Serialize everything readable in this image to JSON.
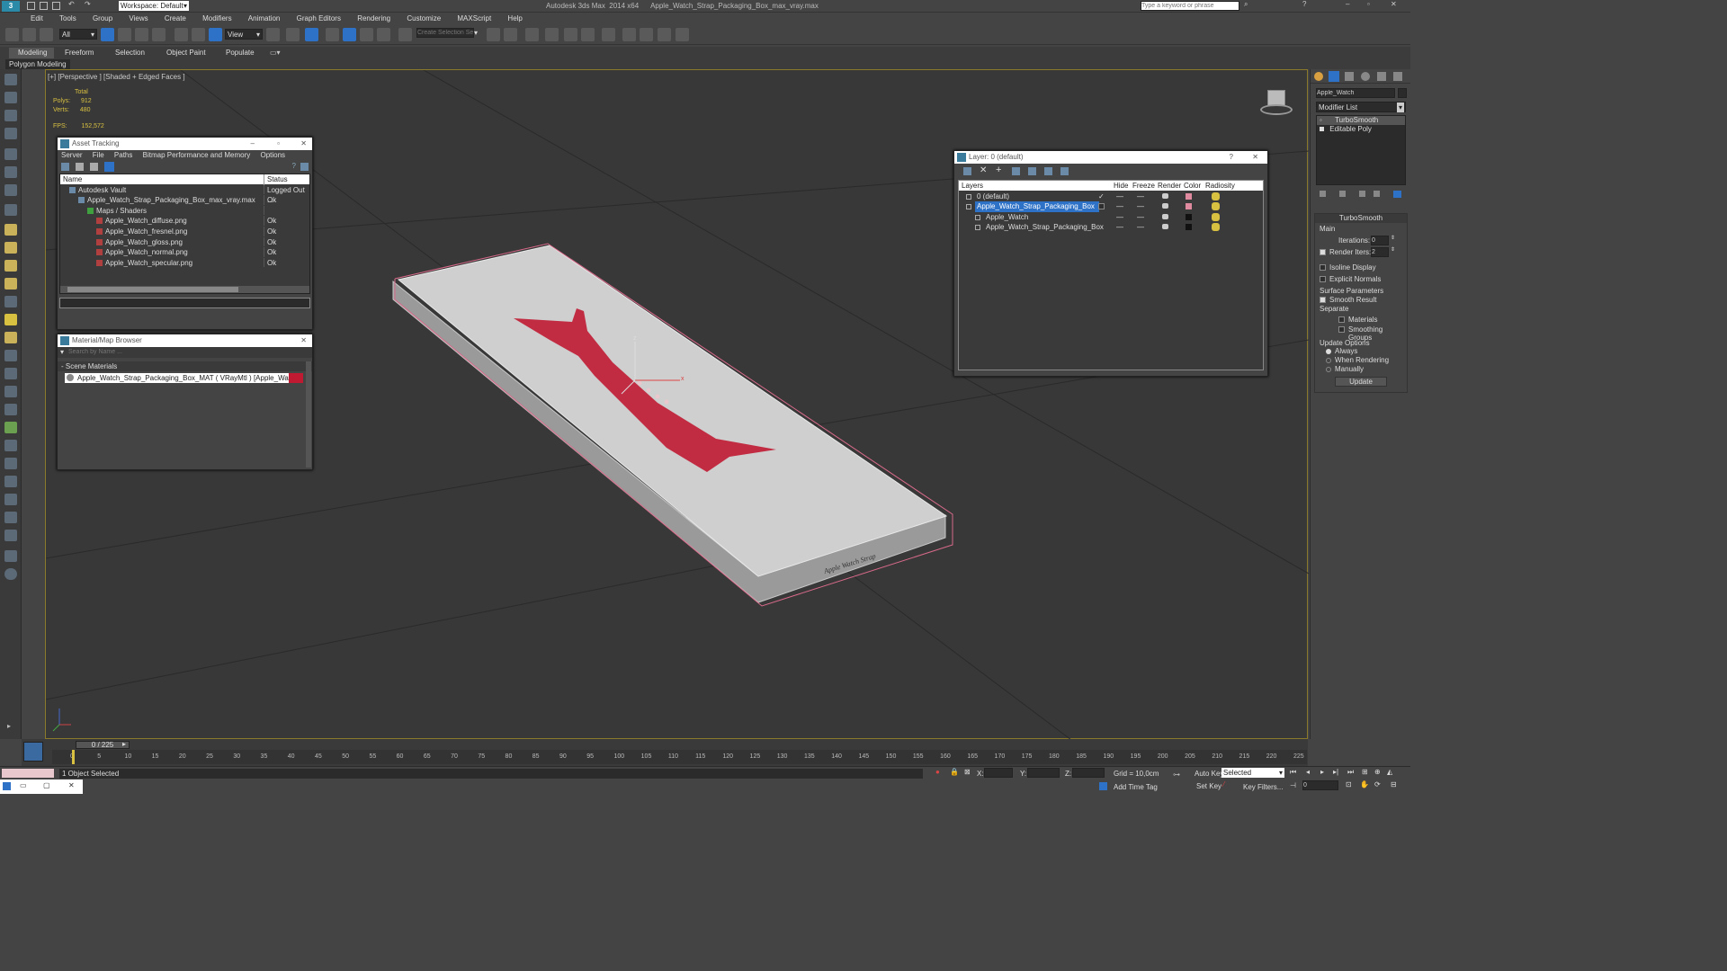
{
  "titlebar": {
    "workspace": "Workspace: Default",
    "title": "Autodesk 3ds Max  2014 x64      Apple_Watch_Strap_Packaging_Box_max_vray.max",
    "search_placeholder": "Type a keyword or phrase"
  },
  "menu": [
    "Edit",
    "Tools",
    "Group",
    "Views",
    "Create",
    "Modifiers",
    "Animation",
    "Graph Editors",
    "Rendering",
    "Customize",
    "MAXScript",
    "Help"
  ],
  "toolbar": {
    "filter_value": "All",
    "view_value": "View",
    "selection_set_placeholder": "Create Selection Se"
  },
  "ribbon": {
    "tabs": [
      "Modeling",
      "Freeform",
      "Selection",
      "Object Paint",
      "Populate"
    ],
    "subtab": "Polygon Modeling"
  },
  "viewport": {
    "label": "[+] [Perspective ] [Shaded + Edged Faces ]",
    "stats": {
      "total": "Total",
      "polys_label": "Polys:",
      "polys": "912",
      "verts_label": "Verts:",
      "verts": "480",
      "fps_label": "FPS:",
      "fps": "152,572"
    },
    "box_text": "Apple Watch Strap",
    "gizmo": {
      "x": "x",
      "z": "z"
    }
  },
  "asset_tracking": {
    "title": "Asset Tracking",
    "menu": [
      "Server",
      "File",
      "Paths",
      "Bitmap Performance and Memory",
      "Options"
    ],
    "columns": [
      "Name",
      "Status"
    ],
    "rows": [
      {
        "name": "Autodesk Vault",
        "status": "Logged Out ...",
        "indent": 1
      },
      {
        "name": "Apple_Watch_Strap_Packaging_Box_max_vray.max",
        "status": "Ok",
        "indent": 2
      },
      {
        "name": "Maps / Shaders",
        "status": "",
        "indent": 3
      },
      {
        "name": "Apple_Watch_diffuse.png",
        "status": "Ok",
        "indent": 4
      },
      {
        "name": "Apple_Watch_fresnel.png",
        "status": "Ok",
        "indent": 4
      },
      {
        "name": "Apple_Watch_gloss.png",
        "status": "Ok",
        "indent": 4
      },
      {
        "name": "Apple_Watch_normal.png",
        "status": "Ok",
        "indent": 4
      },
      {
        "name": "Apple_Watch_specular.png",
        "status": "Ok",
        "indent": 4
      }
    ]
  },
  "material_browser": {
    "title": "Material/Map Browser",
    "search_placeholder": "Search by Name ...",
    "section": "- Scene Materials",
    "item": "Apple_Watch_Strap_Packaging_Box_MAT  ( VRayMtl )  [Apple_Watch]"
  },
  "layer_window": {
    "title": "Layer: 0 (default)",
    "columns": [
      "Layers",
      "Hide",
      "Freeze",
      "Render",
      "Color",
      "Radiosity"
    ],
    "rows": [
      {
        "name": "0 (default)",
        "color": "#e08aa0",
        "selected": false,
        "indent": 0
      },
      {
        "name": "Apple_Watch_Strap_Packaging_Box",
        "color": "#e08aa0",
        "selected": true,
        "indent": 0
      },
      {
        "name": "Apple_Watch",
        "color": "#111111",
        "selected": false,
        "indent": 1
      },
      {
        "name": "Apple_Watch_Strap_Packaging_Box",
        "color": "#111111",
        "selected": false,
        "indent": 1
      }
    ]
  },
  "command_panel": {
    "object_name": "Apple_Watch",
    "modifier_list": "Modifier List",
    "stack": [
      "TurboSmooth",
      "Editable Poly"
    ],
    "rollout_title": "TurboSmooth",
    "main": "Main",
    "iterations_label": "Iterations:",
    "iterations": "0",
    "render_iters_label": "Render Iters:",
    "render_iters": "2",
    "isoline": "Isoline Display",
    "explicit_normals": "Explicit Normals",
    "surface_params": "Surface Parameters",
    "smooth_result": "Smooth Result",
    "separate": "Separate",
    "materials": "Materials",
    "smoothing_groups": "Smoothing Groups",
    "update_options": "Update Options",
    "always": "Always",
    "when_rendering": "When Rendering",
    "manually": "Manually",
    "update_button": "Update"
  },
  "timeline": {
    "frame": "0 / 225",
    "ticks": [
      "0",
      "5",
      "10",
      "15",
      "20",
      "25",
      "30",
      "35",
      "40",
      "45",
      "50",
      "55",
      "60",
      "65",
      "70",
      "75",
      "80",
      "85",
      "90",
      "95",
      "100",
      "105",
      "110",
      "115",
      "120",
      "125",
      "130",
      "135",
      "140",
      "145",
      "150",
      "155",
      "160",
      "165",
      "170",
      "175",
      "180",
      "185",
      "190",
      "195",
      "200",
      "205",
      "210",
      "215",
      "220",
      "225"
    ]
  },
  "status": {
    "selected": "1 Object Selected",
    "x": "X:",
    "y": "Y:",
    "z": "Z:",
    "grid": "Grid = 10,0cm",
    "add_time_tag": "Add Time Tag",
    "auto_key": "Auto Key",
    "set_key": "Set Key",
    "selected_option": "Selected",
    "key_filters": "Key Filters...",
    "frame_value": "0"
  },
  "colors": {
    "accent": "#2e72c8",
    "strap": "#c01a32",
    "viewport_border": "#8a7a2a"
  }
}
